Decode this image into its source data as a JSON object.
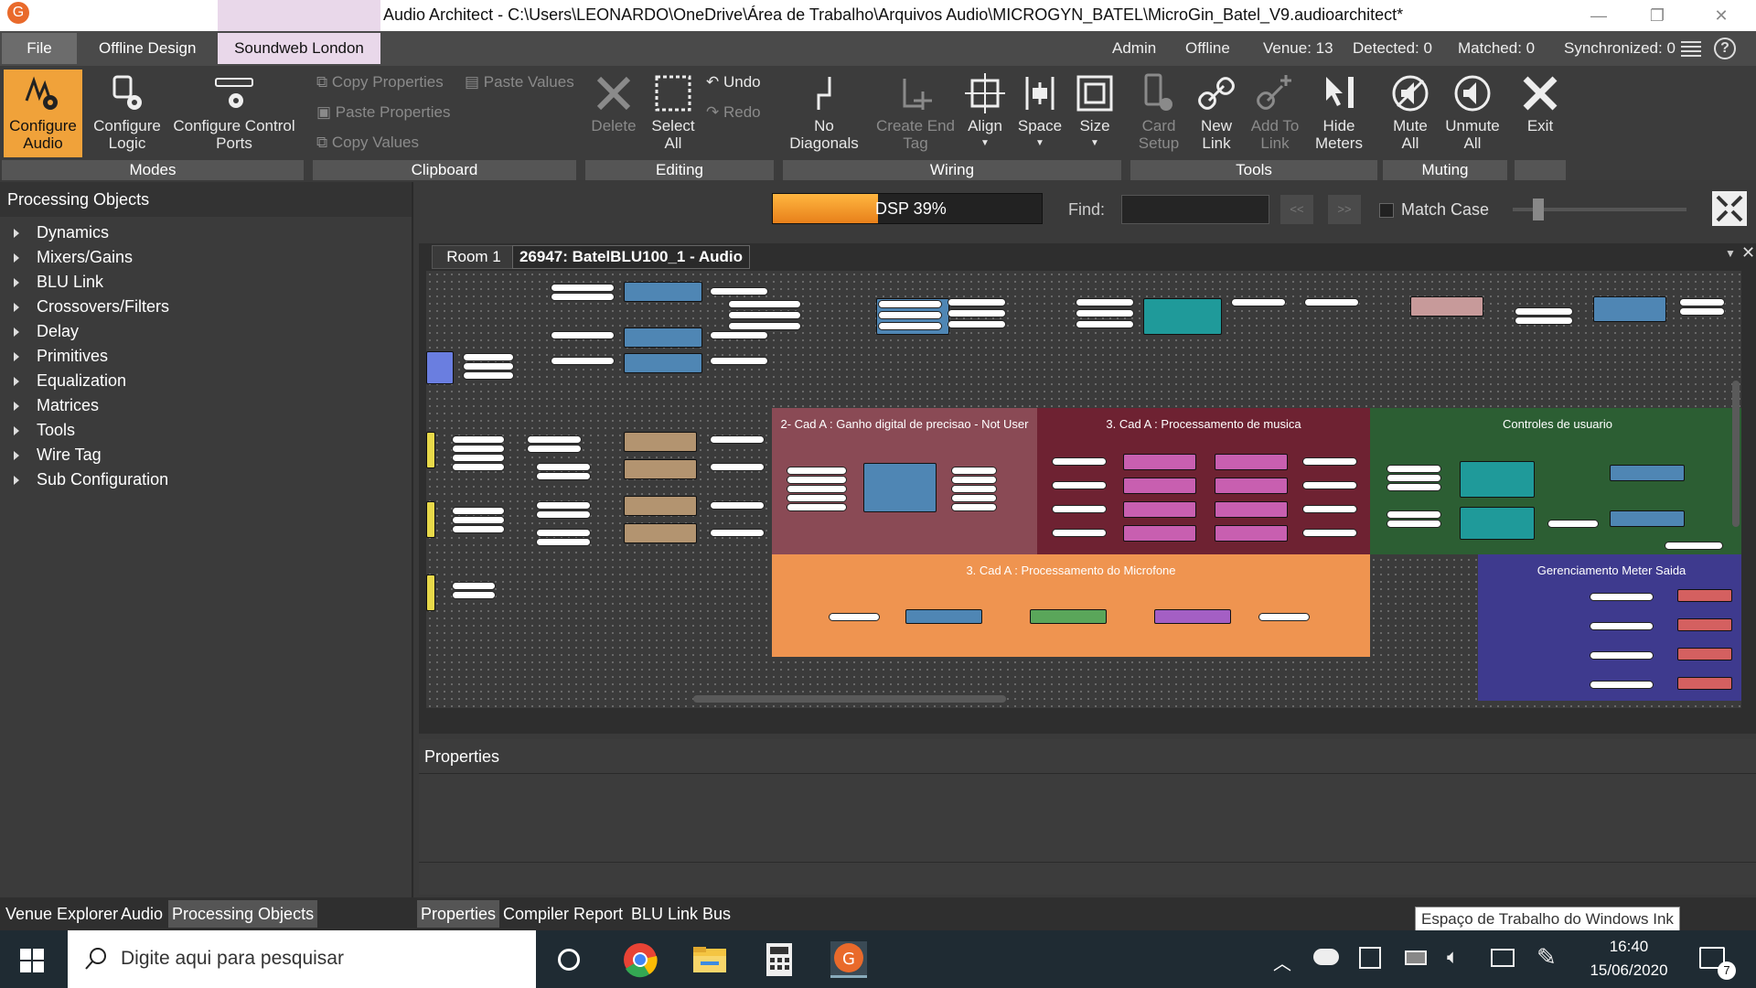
{
  "window": {
    "title": "Audio Architect - C:\\Users\\LEONARDO\\OneDrive\\Área de Trabalho\\Arquivos Audio\\MICROGYN_BATEL\\MicroGin_Batel_V9.audioarchitect*",
    "minimize": "—",
    "maximize": "❐",
    "close": "✕"
  },
  "menu": {
    "file": "File",
    "offline_design": "Offline Design",
    "soundweb": "Soundweb London"
  },
  "status": {
    "user": "Admin",
    "mode": "Offline",
    "venue": "Venue: 13",
    "detected": "Detected: 0",
    "matched": "Matched: 0",
    "synchronized": "Synchronized: 0"
  },
  "ribbon": {
    "modes": {
      "label": "Modes",
      "configure_audio": "Configure Audio",
      "configure_logic": "Configure Logic",
      "configure_control": "Configure Control Ports"
    },
    "clipboard": {
      "label": "Clipboard",
      "copy_properties": "Copy Properties",
      "paste_values": "Paste Values",
      "paste_properties": "Paste Properties",
      "copy_values": "Copy Values"
    },
    "editing": {
      "label": "Editing",
      "delete": "Delete",
      "select_all": "Select All",
      "undo": "Undo",
      "redo": "Redo"
    },
    "wiring": {
      "label": "Wiring",
      "no_diagonals": "No Diagonals",
      "create_end_tag": "Create End Tag",
      "align": "Align",
      "space": "Space",
      "size": "Size"
    },
    "tools": {
      "label": "Tools",
      "card_setup": "Card Setup",
      "new_link": "New Link",
      "add_to_link": "Add To Link",
      "hide_meters": "Hide Meters"
    },
    "muting": {
      "label": "Muting",
      "mute_all": "Mute All",
      "unmute_all": "Unmute All"
    },
    "exit": {
      "label": "Exit"
    }
  },
  "left_panel": {
    "title": "Processing Objects",
    "items": [
      "Dynamics",
      "Mixers/Gains",
      "BLU Link",
      "Crossovers/Filters",
      "Delay",
      "Primitives",
      "Equalization",
      "Matrices",
      "Tools",
      "Wire Tag",
      "Sub Configuration"
    ]
  },
  "toolbar": {
    "dsp_label": "DSP 39%",
    "dsp_percent": 39,
    "find_label": "Find:",
    "prev": "<<",
    "next": ">>",
    "match_case": "Match Case"
  },
  "doc_tabs": {
    "room": "Room 1",
    "device": "26947: BatelBLU100_1 - Audio"
  },
  "zones": {
    "gain": "2- Cad A : Ganho digital de precisao - Not User",
    "music": "3. Cad A : Processamento de musica",
    "user_controls": "Controles de usuario",
    "mic": "3. Cad A : Processamento do Microfone",
    "meter": "Gerenciamento Meter Saida"
  },
  "properties": {
    "title": "Properties"
  },
  "bottom_tabs": {
    "left": [
      "Venue Explorer",
      "Audio",
      "Processing Objects"
    ],
    "right": [
      "Properties",
      "Compiler Report",
      "BLU Link Bus"
    ]
  },
  "tooltip": "Espaço de Trabalho do Windows Ink",
  "taskbar": {
    "search_placeholder": "Digite aqui para pesquisar",
    "time": "16:40",
    "date": "15/06/2020",
    "notifications": "7"
  },
  "colors": {
    "accent": "#f0a23a",
    "zone_gain": "#8a4a55",
    "zone_music": "#6e2232",
    "zone_user": "#2c5e33",
    "zone_mic": "#ef9450",
    "zone_meter": "#3e3a8e"
  }
}
